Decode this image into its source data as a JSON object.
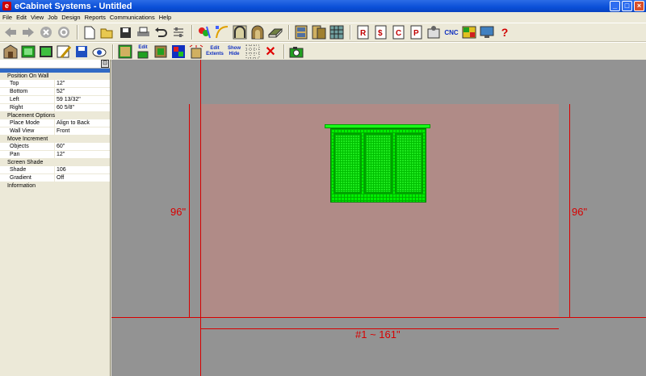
{
  "window": {
    "title": "eCabinet Systems - Untitled",
    "app_icon": "e",
    "minimize": "_",
    "maximize": "□",
    "close": "×"
  },
  "menu": [
    "File",
    "Edit",
    "View",
    "Job",
    "Design",
    "Reports",
    "Communications",
    "Help"
  ],
  "toolbar1": {
    "cnc_label": "CNC",
    "help_label": "?",
    "icons": [
      "back-arrow-icon",
      "forward-arrow-icon",
      "stop-icon",
      "refresh-icon",
      "new-file-icon",
      "open-folder-icon",
      "save-icon",
      "print-icon",
      "undo-icon",
      "settings-sliders-icon",
      "paint-icon",
      "curve-edit-icon",
      "arch-icon",
      "arch-door-icon",
      "panel-icon",
      "cabinet-icon",
      "cabinets-icon",
      "grid-icon",
      "report-icon",
      "report-2-icon",
      "report-3-icon",
      "report-4-icon",
      "machine-icon",
      "cnc-icon",
      "layout-icon",
      "monitor-icon",
      "help-icon"
    ]
  },
  "toolbar2": {
    "edit_label": "Edit",
    "edit_extents_label": "Edit Extents",
    "show_hide_label": "Show Hide",
    "delete_label": "✕",
    "icons": [
      "room-3d-icon",
      "wall-view-icon",
      "elevation-icon",
      "tools-icon",
      "floppy-icon",
      "render-eye-icon",
      "cabinet-view-icon",
      "edit-icon",
      "parts-icon",
      "color-icon",
      "exploded-icon",
      "edit-extents-icon",
      "show-hide-icon",
      "dotted-grid-icon",
      "delete-icon",
      "camera-icon"
    ]
  },
  "properties": {
    "pin_label": "⊡",
    "groups": [
      {
        "label": "Position On Wall",
        "rows": [
          {
            "name": "Top",
            "value": "12\""
          },
          {
            "name": "Bottom",
            "value": "52\""
          },
          {
            "name": "Left",
            "value": "59 13/32\""
          },
          {
            "name": "Right",
            "value": "60 5/8\""
          }
        ]
      },
      {
        "label": "Placement Options",
        "rows": [
          {
            "name": "Place Mode",
            "value": "Align to Back"
          },
          {
            "name": "Wall View",
            "value": "Front"
          }
        ]
      },
      {
        "label": "Move Increment",
        "rows": [
          {
            "name": "Objects",
            "value": "60\""
          },
          {
            "name": "Pan",
            "value": "12\""
          }
        ]
      },
      {
        "label": "Screen Shade",
        "rows": [
          {
            "name": "Shade",
            "value": "106"
          },
          {
            "name": "Gradient",
            "value": "Off"
          }
        ]
      },
      {
        "label": "Information",
        "rows": []
      }
    ]
  },
  "canvas": {
    "left_dim": "96\"",
    "right_dim": "96\"",
    "bottom_dim": "#1 ~ 161\"",
    "colors": {
      "background": "#939393",
      "wall": "#b08b87",
      "dimension": "#d80000",
      "cabinet": "#00f000"
    }
  }
}
